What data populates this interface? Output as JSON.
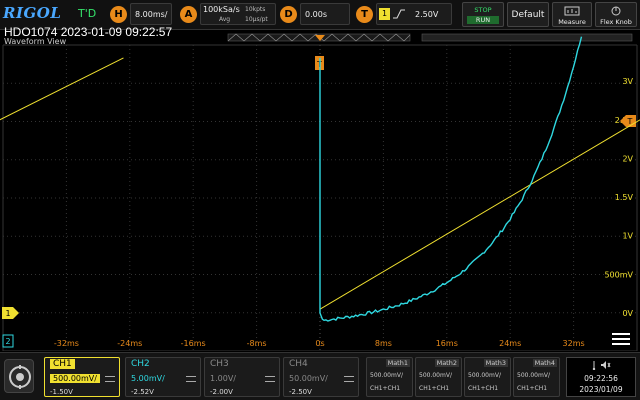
{
  "topbar": {
    "logo": "RIGOL",
    "mode": "T'D",
    "horizontal": {
      "badge": "H",
      "value": "8.00ms/"
    },
    "acquire": {
      "badge": "A",
      "rate": "100kSa/s",
      "depth": "10kpts",
      "mode": "Avg",
      "time": "10μs/pt"
    },
    "delay": {
      "badge": "D",
      "value": "0.00s"
    },
    "trigger": {
      "badge": "T",
      "source": "1",
      "level": "2.50V"
    },
    "buttons": {
      "stop_line1": "STOP",
      "stop_line2": "RUN",
      "default": "Default",
      "measure": "Measure",
      "flex_knob": "Flex Knob"
    }
  },
  "header": {
    "title": "HDO1074 2023-01-09 09:22:57",
    "subtitle": "Waveform View"
  },
  "plot": {
    "volt_labels": [
      "3V",
      "2.5V",
      "2V",
      "1.5V",
      "1V",
      "500mV",
      "0V"
    ],
    "time_labels": [
      "-32ms",
      "-24ms",
      "-16ms",
      "-8ms",
      "0s",
      "8ms",
      "16ms",
      "24ms",
      "32ms"
    ],
    "ch1_marker": "1",
    "ch2_marker": "2",
    "trigger_marker": "T",
    "trigger_level_marker": "T",
    "colors": {
      "ch1": "#f0e030",
      "ch2": "#2fd8e0",
      "accent": "#e88a1a",
      "grid": "#3a3a3a"
    }
  },
  "channels": [
    {
      "name": "CH1",
      "scale": "500.00mV/",
      "offset": "-1.50V",
      "color": "#f0e030"
    },
    {
      "name": "CH2",
      "scale": "5.00mV/",
      "offset": "-2.52V",
      "color": "#2fd8e0"
    },
    {
      "name": "CH3",
      "scale": "1.00V/",
      "offset": "-2.00V",
      "color": "#888888"
    },
    {
      "name": "CH4",
      "scale": "50.00mV/",
      "offset": "-2.50V",
      "color": "#888888"
    }
  ],
  "maths": [
    {
      "name": "Math1",
      "scale": "500.00mV/",
      "source": "CH1+CH1"
    },
    {
      "name": "Math2",
      "scale": "500.00mV/",
      "source": "CH1+CH1"
    },
    {
      "name": "Math3",
      "scale": "500.00mV/",
      "source": "CH1+CH1"
    },
    {
      "name": "Math4",
      "scale": "500.00mV/",
      "source": "CH1+CH1"
    }
  ],
  "clock": {
    "time": "09:22:56",
    "date": "2023/01/09"
  }
}
